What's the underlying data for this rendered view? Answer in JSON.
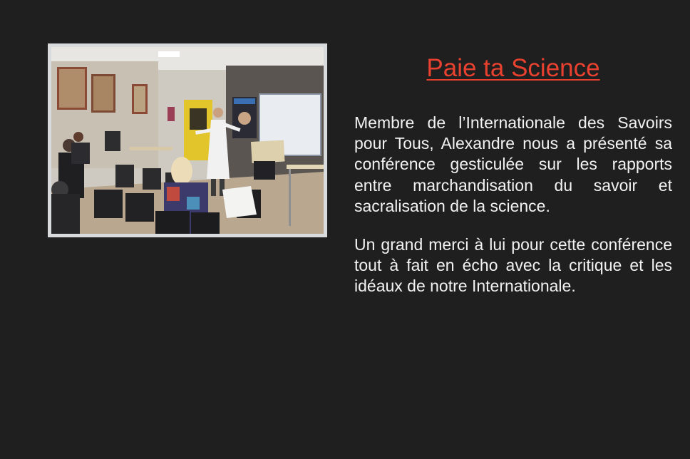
{
  "page": {
    "title": "Paie ta Science",
    "paragraphs": [
      "Membre de l’Internationale des Savoirs pour Tous, Alexandre nous a présenté sa conférence gesticulée sur les rapports entre marchandisation du savoir et sacralisation de la science.",
      "Un grand merci à lui pour cette conférence tout à fait en écho avec la critique et les idéaux de notre Internationale."
    ]
  },
  "colors": {
    "background": "#201f1f",
    "title": "#e8412f",
    "text": "#f2f2f2",
    "frame": "#d9dadb"
  }
}
